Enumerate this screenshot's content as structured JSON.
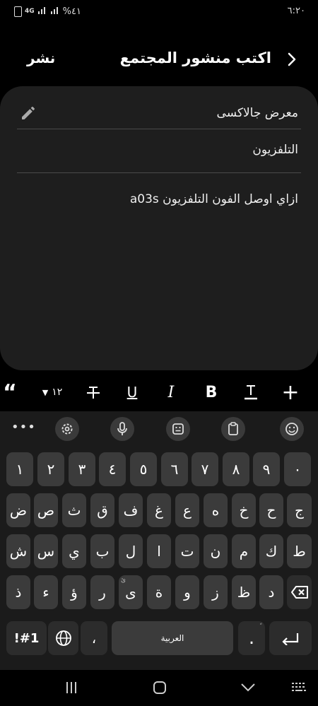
{
  "status_bar": {
    "time": "٦:٢٠",
    "battery": "%٤١",
    "network": "4G"
  },
  "header": {
    "title": "اكتب منشور المجتمع",
    "publish_label": "نشر"
  },
  "post": {
    "category": "معرض جالاكسى",
    "title": "التلفزيون",
    "body": "ازاي اوصل الفون  التلفزيون a03s"
  },
  "format_bar": {
    "font_size": "١٢",
    "quote_glyph": "“",
    "italic": "I",
    "bold": "B",
    "underline": "U",
    "plus": "+"
  },
  "keyboard": {
    "more": "•••",
    "digits": [
      "١",
      "٢",
      "٣",
      "٤",
      "٥",
      "٦",
      "٧",
      "٨",
      "٩",
      "٠"
    ],
    "row1": [
      "ض",
      "ص",
      "ث",
      "ق",
      "ف",
      "غ",
      "ع",
      "ه",
      "خ",
      "ح",
      "ج"
    ],
    "row2": [
      "ش",
      "س",
      "ي",
      "ب",
      "ل",
      "ا",
      "ت",
      "ن",
      "م",
      "ك",
      "ط"
    ],
    "row3": [
      "ذ",
      "ء",
      "ؤ",
      "ر",
      "ى",
      "ة",
      "و",
      "ز",
      "ظ",
      "د"
    ],
    "row3_hint": "ئ",
    "symbols_label": "!#1",
    "comma": "،",
    "space_label": "العربية",
    "period": ".",
    "period_hint": "ً"
  },
  "icons": {
    "edit": "pencil-icon",
    "back": "chevron-right-icon",
    "settings": "gear-icon",
    "mic": "microphone-icon",
    "sticker": "sticker-icon",
    "clipboard": "clipboard-icon",
    "emoji": "emoji-icon"
  }
}
